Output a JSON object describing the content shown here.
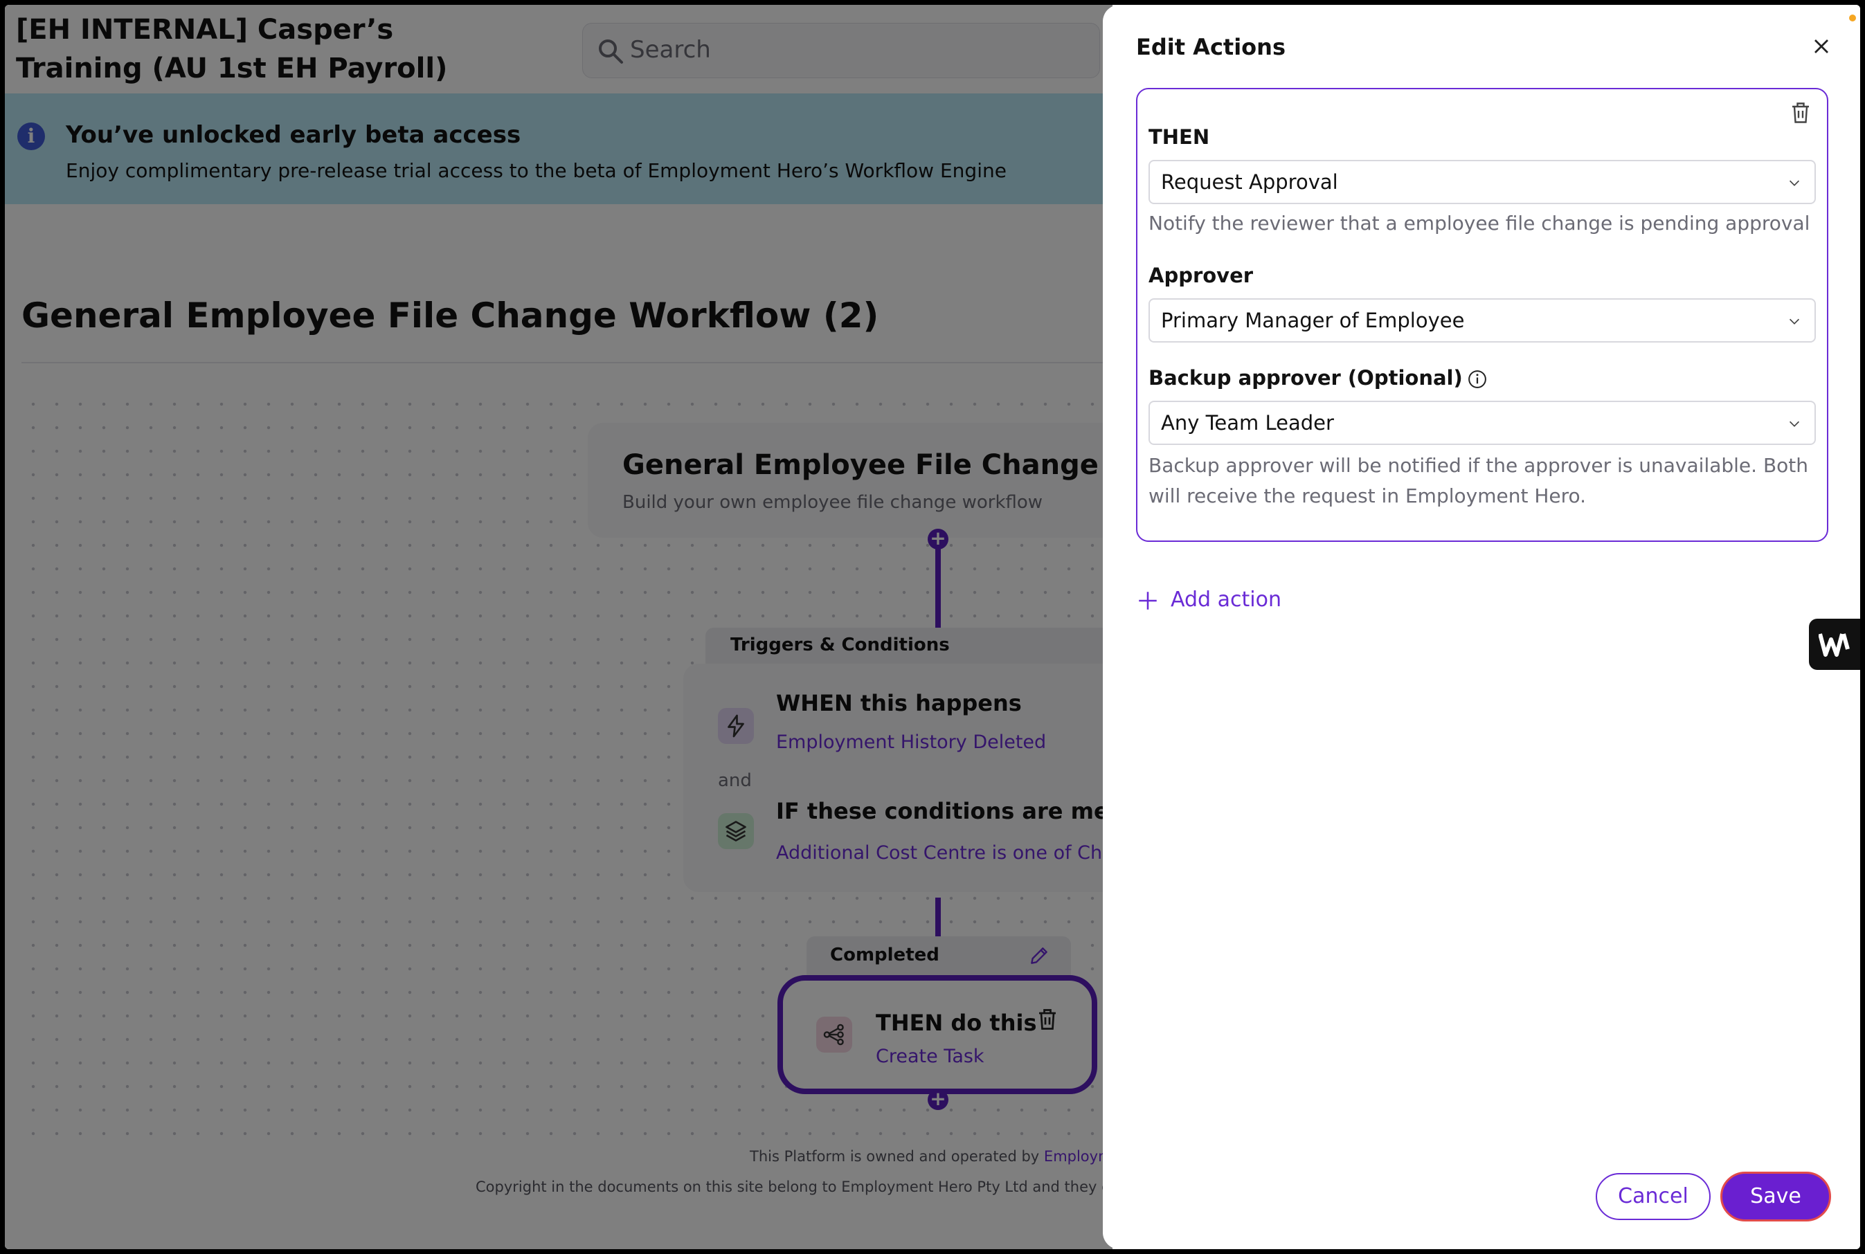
{
  "app": {
    "org_title": "[EH INTERNAL] Casper’s Training (AU 1st EH Payroll)",
    "search_placeholder": "Search"
  },
  "banner": {
    "title": "You’ve unlocked early beta access",
    "description": "Enjoy complimentary pre-release trial access to the beta of Employment Hero’s Workflow Engine"
  },
  "workflow": {
    "page_title": "General Employee File Change Workflow (2)",
    "card_title": "General Employee File Change Workflow",
    "card_subtitle": "Build your own employee file change workflow",
    "triggers_tab": "Triggers & Conditions",
    "when_title": "WHEN this happens",
    "when_value": "Employment History Deleted",
    "and_label": "and",
    "if_title": "IF these conditions are met",
    "if_value": "Additional Cost Centre is one of Christchurch",
    "completed_tab": "Completed",
    "then_title": "THEN do this",
    "then_value": "Create Task"
  },
  "footer": {
    "line1_prefix": "This Platform is owned and operated by ",
    "line1_link": "Employment Hero Pty Ltd",
    "line2": "Copyright in the documents on this site belong to Employment Hero Pty Ltd and they cannot be reproduced"
  },
  "drawer": {
    "title": "Edit Actions",
    "then_label": "THEN",
    "then_value": "Request Approval",
    "then_help": "Notify the reviewer that a employee file change is pending approval",
    "approver_label": "Approver",
    "approver_value": "Primary Manager of Employee",
    "backup_label": "Backup approver (Optional)",
    "backup_value": "Any Team Leader",
    "backup_help": "Backup approver will be notified if the approver is unavailable. Both will receive the request in Employment Hero.",
    "add_action": "Add action",
    "cancel": "Cancel",
    "save": "Save"
  },
  "icons": {
    "search": "search-icon",
    "info": "info-icon",
    "lightning": "lightning-icon",
    "layers": "layers-icon",
    "share": "share-nodes-icon",
    "pencil": "pencil-icon",
    "trash": "trash-icon",
    "close": "close-icon",
    "chevron": "chevron-down-icon",
    "plus": "plus-icon",
    "brand": "w-logo-icon"
  },
  "colors": {
    "accent": "#6a2bd6",
    "save_button": "#6a1fd0",
    "banner_bg": "#b9e6f4",
    "connector": "#5a1fbf"
  }
}
